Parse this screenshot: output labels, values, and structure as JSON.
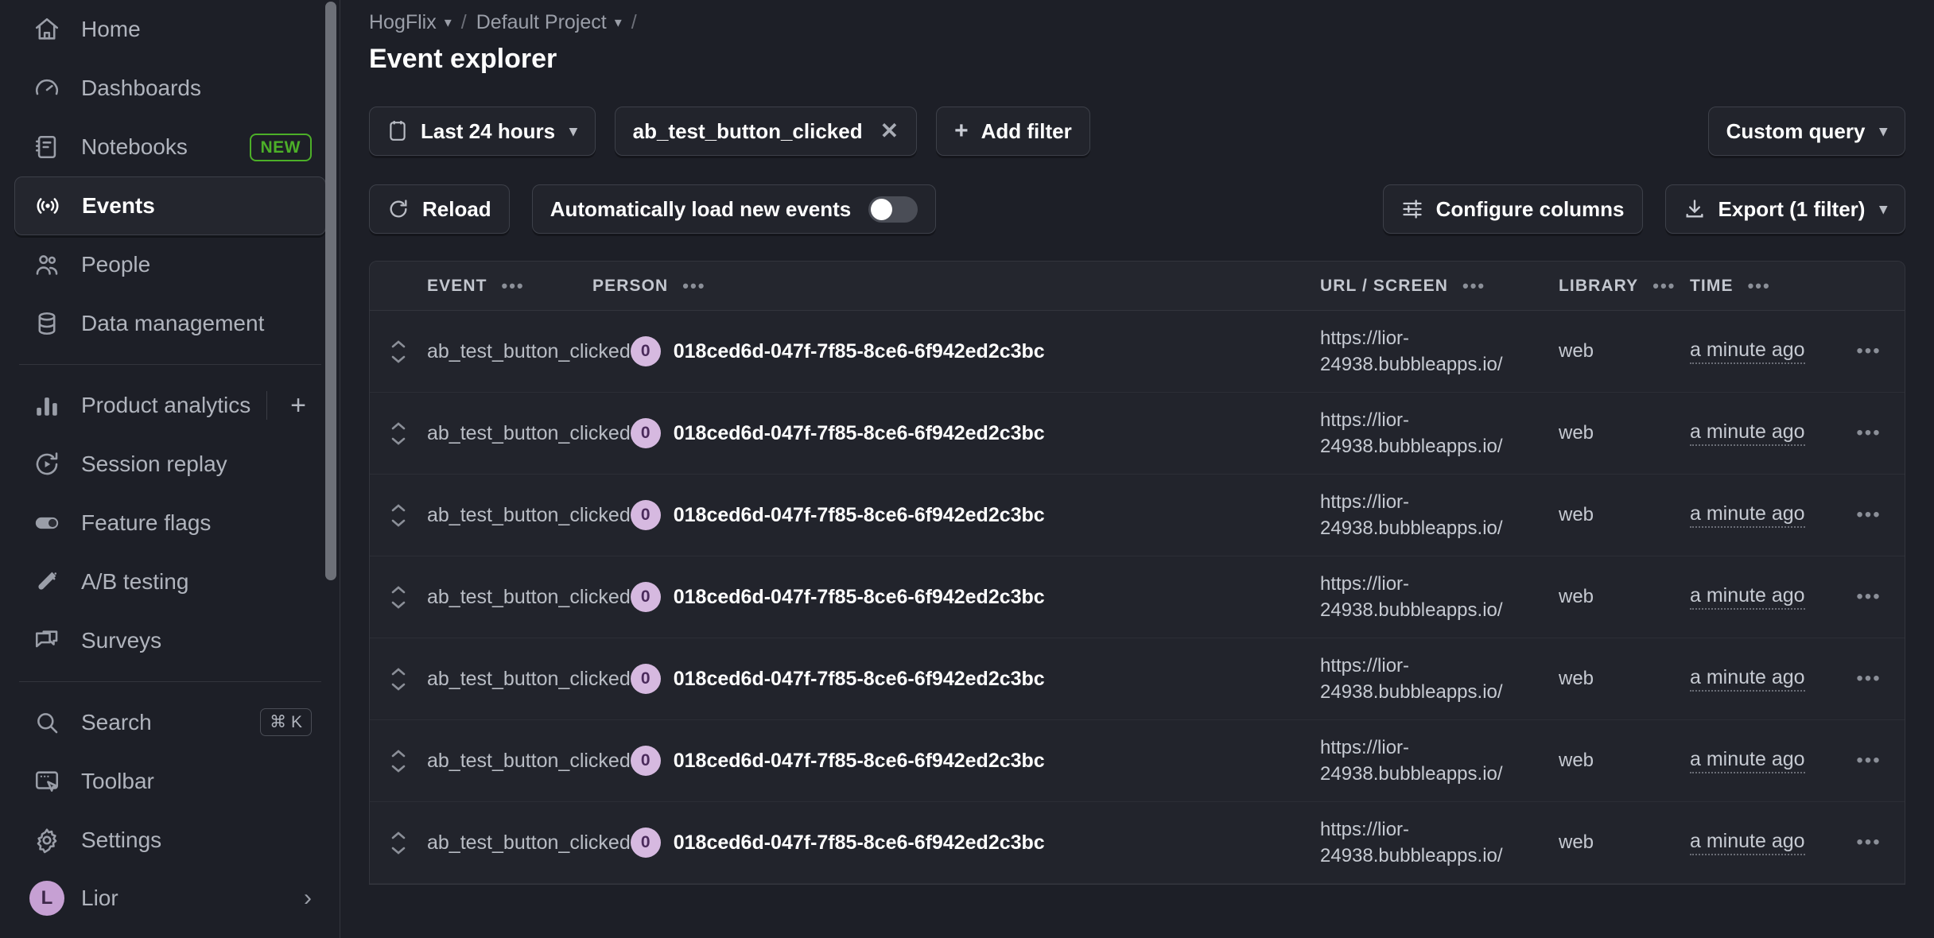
{
  "sidebar": {
    "top_items": [
      {
        "label": "Home",
        "icon": "home-icon",
        "active": false
      },
      {
        "label": "Dashboards",
        "icon": "gauge-icon",
        "active": false
      },
      {
        "label": "Notebooks",
        "icon": "notebook-icon",
        "active": false,
        "badge": "NEW"
      },
      {
        "label": "Events",
        "icon": "broadcast-icon",
        "active": true
      },
      {
        "label": "People",
        "icon": "people-icon",
        "active": false
      },
      {
        "label": "Data management",
        "icon": "database-icon",
        "active": false
      }
    ],
    "mid_items": [
      {
        "label": "Product analytics",
        "icon": "bar-chart-icon",
        "has_plus": true
      },
      {
        "label": "Session replay",
        "icon": "replay-icon"
      },
      {
        "label": "Feature flags",
        "icon": "toggle-icon"
      },
      {
        "label": "A/B testing",
        "icon": "flask-icon"
      },
      {
        "label": "Surveys",
        "icon": "chat-icon"
      }
    ],
    "bottom_items": [
      {
        "label": "Search",
        "icon": "search-icon",
        "shortcut": "⌘ K"
      },
      {
        "label": "Toolbar",
        "icon": "toolbar-icon"
      },
      {
        "label": "Settings",
        "icon": "gear-icon"
      }
    ],
    "user": {
      "label": "Lior",
      "initial": "L",
      "chevron": "›"
    }
  },
  "header": {
    "breadcrumb": {
      "org": "HogFlix",
      "project": "Default Project",
      "separator": "/",
      "trailing_separator": "/"
    },
    "title": "Event explorer"
  },
  "filters": {
    "date_range": "Last 24 hours",
    "event_filter": "ab_test_button_clicked",
    "event_filter_remove": "✕",
    "add_filter": "Add filter",
    "add_filter_plus": "+",
    "custom_query": "Custom query"
  },
  "toolbar": {
    "reload": "Reload",
    "auto_load": "Automatically load new events",
    "auto_load_enabled": false,
    "configure_columns": "Configure columns",
    "export": "Export (1 filter)"
  },
  "table": {
    "columns": [
      "EVENT",
      "PERSON",
      "URL / SCREEN",
      "LIBRARY",
      "TIME"
    ],
    "column_menu": "•••",
    "rows": [
      {
        "event": "ab_test_button_clicked",
        "person_initial": "0",
        "person": "018ced6d-047f-7f85-8ce6-6f942ed2c3bc",
        "url": "https://lior-24938.bubbleapps.io/",
        "library": "web",
        "time": "a minute ago"
      },
      {
        "event": "ab_test_button_clicked",
        "person_initial": "0",
        "person": "018ced6d-047f-7f85-8ce6-6f942ed2c3bc",
        "url": "https://lior-24938.bubbleapps.io/",
        "library": "web",
        "time": "a minute ago"
      },
      {
        "event": "ab_test_button_clicked",
        "person_initial": "0",
        "person": "018ced6d-047f-7f85-8ce6-6f942ed2c3bc",
        "url": "https://lior-24938.bubbleapps.io/",
        "library": "web",
        "time": "a minute ago"
      },
      {
        "event": "ab_test_button_clicked",
        "person_initial": "0",
        "person": "018ced6d-047f-7f85-8ce6-6f942ed2c3bc",
        "url": "https://lior-24938.bubbleapps.io/",
        "library": "web",
        "time": "a minute ago"
      },
      {
        "event": "ab_test_button_clicked",
        "person_initial": "0",
        "person": "018ced6d-047f-7f85-8ce6-6f942ed2c3bc",
        "url": "https://lior-24938.bubbleapps.io/",
        "library": "web",
        "time": "a minute ago"
      },
      {
        "event": "ab_test_button_clicked",
        "person_initial": "0",
        "person": "018ced6d-047f-7f85-8ce6-6f942ed2c3bc",
        "url": "https://lior-24938.bubbleapps.io/",
        "library": "web",
        "time": "a minute ago"
      },
      {
        "event": "ab_test_button_clicked",
        "person_initial": "0",
        "person": "018ced6d-047f-7f85-8ce6-6f942ed2c3bc",
        "url": "https://lior-24938.bubbleapps.io/",
        "library": "web",
        "time": "a minute ago"
      }
    ],
    "row_menu": "•••"
  },
  "colors": {
    "background": "#1d1f27",
    "surface": "#22242c",
    "border": "#33353d",
    "accent_new": "#4caf28",
    "person_badge": "#d6b9e0",
    "avatar": "#c6a0d3",
    "text_primary": "#ffffff",
    "text_muted": "#b0b4bd"
  }
}
